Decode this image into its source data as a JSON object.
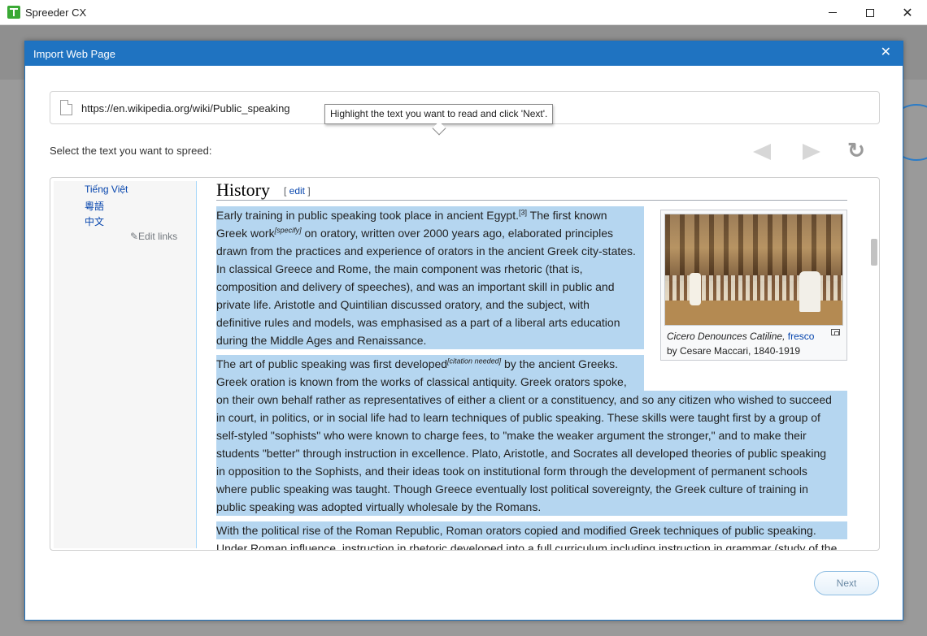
{
  "app": {
    "title": "Spreeder CX"
  },
  "window_controls": {
    "minimize": "minimize",
    "maximize": "maximize",
    "close": "✕"
  },
  "dialog": {
    "title": "Import Web Page",
    "close": "✕",
    "url": "https://en.wikipedia.org/wiki/Public_speaking",
    "select_label": "Select the text you want to spreed:",
    "tooltip": "Highlight the text you want to read and click 'Next'.",
    "refresh_glyph": "↻",
    "next_button": "Next"
  },
  "wiki": {
    "languages": [
      "Tiếng Việt",
      "粵語",
      "中文"
    ],
    "edit_links": "✎Edit links",
    "heading": "History",
    "heading_edit": {
      "open": "[ ",
      "link": "edit",
      "close": " ]"
    },
    "thumb": {
      "caption_title": "Cicero Denounces Catiline,",
      "caption_link": "fresco",
      "caption_by": "by Cesare Maccari, 1840-1919"
    },
    "lines": [
      {
        "a": "Early training in public speaking took place in ancient Egypt.",
        "sup": "[3]",
        "b": " The first known"
      },
      {
        "a": "Greek work",
        "sup": "[specify]",
        "b": " on oratory, written over 2000 years ago, elaborated principles"
      },
      {
        "a": "drawn from the practices and experience of orators in the ancient Greek city-states."
      },
      {
        "a": "In classical Greece and Rome, the main component was rhetoric (that is,"
      },
      {
        "a": "composition and delivery of speeches), and was an important skill in public and"
      },
      {
        "a": "private life. Aristotle and Quintilian discussed oratory, and the subject, with"
      },
      {
        "a": "definitive rules and models, was emphasised as a part of a liberal arts education"
      },
      {
        "a": "during the Middle Ages and Renaissance."
      },
      {
        "a": "The art of public speaking was first developed",
        "sup": "[citation needed]",
        "b": " by the ancient Greeks."
      },
      {
        "a": "Greek oration is known from the works of classical antiquity. Greek orators spoke,"
      },
      {
        "a": "on their own behalf rather as representatives of either a client or a constituency, and so any citizen who wished to succeed"
      },
      {
        "a": "in court, in politics, or in social life had to learn techniques of public speaking. These skills were taught first by a group of"
      },
      {
        "a": "self-styled \"sophists\" who were known to charge fees, to \"make the weaker argument the stronger,\" and to make their"
      },
      {
        "a": "students \"better\" through instruction in excellence. Plato, Aristotle, and Socrates all developed theories of public speaking"
      },
      {
        "a": "in opposition to the Sophists, and their ideas took on institutional form through the development of permanent schools"
      },
      {
        "a": "where public speaking was taught. Though Greece eventually lost political sovereignty, the Greek culture of training in"
      },
      {
        "a": "public speaking was adopted virtually wholesale by the Romans."
      },
      {
        "a": "With the political rise of the Roman Republic, Roman orators copied and modified Greek techniques of public speaking."
      },
      {
        "a": "Under Roman influence, instruction in rhetoric developed into a full curriculum including instruction in grammar (study of the"
      }
    ]
  },
  "colors": {
    "accent": "#1f73c1",
    "selection": "#b5d6f0",
    "link": "#0645ad"
  }
}
